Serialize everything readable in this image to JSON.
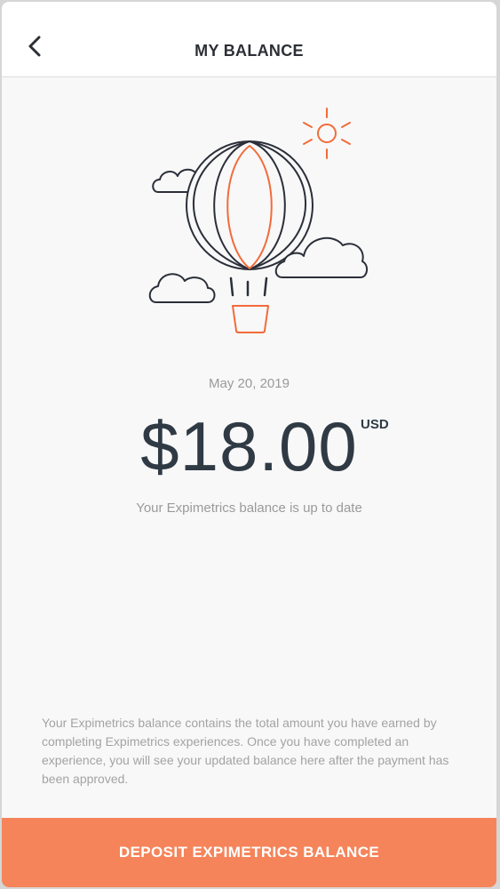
{
  "header": {
    "title": "MY BALANCE",
    "back_icon": "chevron-left-icon"
  },
  "illustration": {
    "icon": "hot-air-balloon-icon",
    "accent_color": "#f26b3a",
    "line_color": "#2b2f3a"
  },
  "balance": {
    "date": "May 20, 2019",
    "amount": "$18.00",
    "currency": "USD",
    "status": "Your Expimetrics balance is up to date"
  },
  "info_text": "Your Expimetrics balance contains the total amount you have earned by completing Expimetrics experiences. Once you have completed an experience, you will see your updated balance here after the payment has been approved.",
  "actions": {
    "deposit_label": "DEPOSIT EXPIMETRICS BALANCE",
    "deposit_color": "#f5845a"
  }
}
